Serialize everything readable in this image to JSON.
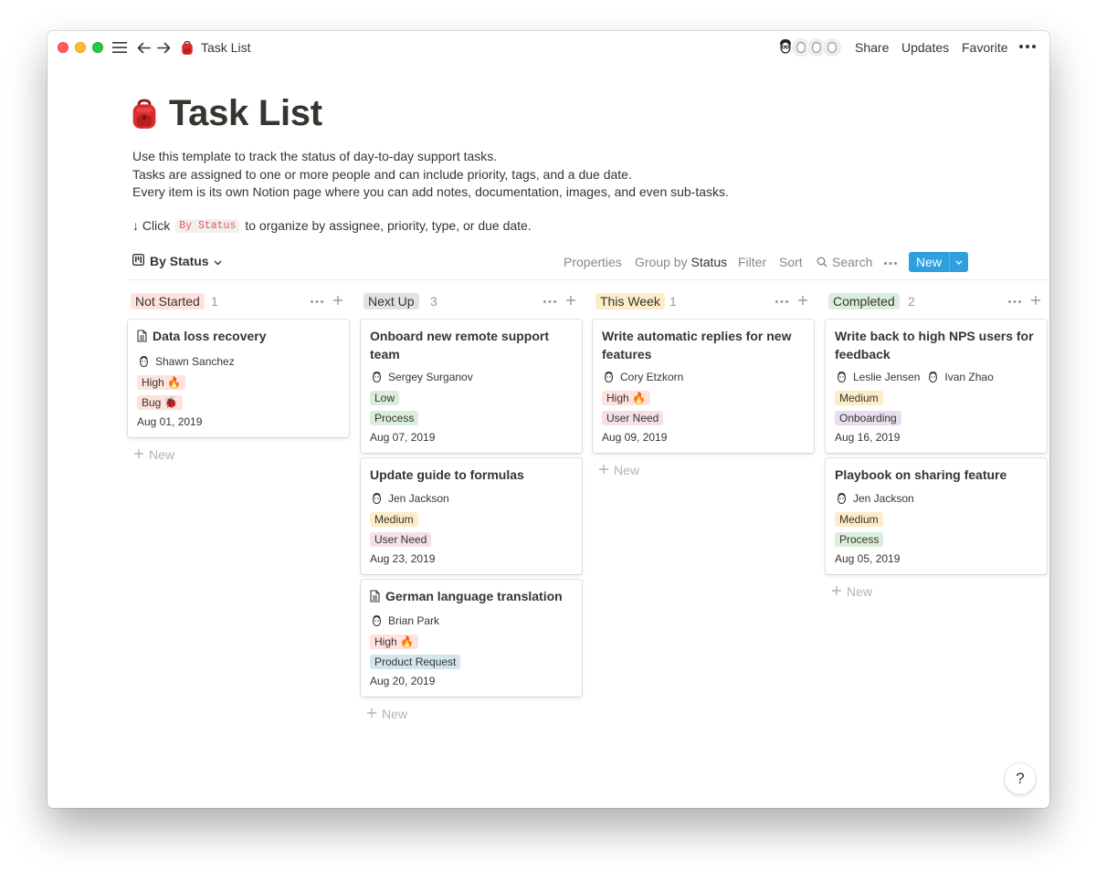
{
  "titlebar": {
    "title": "Task List",
    "share": "Share",
    "updates": "Updates",
    "favorite": "Favorite",
    "page_icon": "backpack-icon"
  },
  "page": {
    "title": "Task List",
    "icon": "backpack-icon",
    "description": [
      "Use this template to track the status of day-to-day support tasks.",
      "Tasks are assigned to one or more people and can include priority, tags, and a due date.",
      "Every item is its own Notion page where you can add notes, documentation, images, and even sub-tasks."
    ],
    "hint": {
      "prefix": "↓ Click",
      "code": "By Status",
      "suffix": "to organize by assignee, priority, type, or due date."
    }
  },
  "viewbar": {
    "view_name": "By Status",
    "properties": "Properties",
    "group_by_label": "Group by",
    "group_by_value": "Status",
    "filter": "Filter",
    "sort": "Sort",
    "search": "Search",
    "new": "New"
  },
  "colors": {
    "accent": "#2f9fe0",
    "not_started": "#ffe2dd",
    "next_up": "#e3e2e0",
    "this_week": "#fdecc8",
    "completed": "#dbeddb",
    "tag_red": "#ffe2dd",
    "tag_green": "#dbeddb",
    "tag_yellow": "#fdecc8",
    "tag_pink": "#f5e0e9",
    "tag_blue": "#d3e5ef",
    "tag_purple": "#e8deee"
  },
  "board": {
    "new_label": "New",
    "columns": [
      {
        "name": "Not Started",
        "count": "1",
        "cards": [
          {
            "title": "Data loss recovery",
            "doc": true,
            "people": [
              "Shawn Sanchez"
            ],
            "priority": "High 🔥",
            "type": "Bug 🐞",
            "date": "Aug 01, 2019"
          }
        ]
      },
      {
        "name": "Next Up",
        "count": "3",
        "cards": [
          {
            "title": "Onboard new remote support team",
            "doc": false,
            "people": [
              "Sergey Surganov"
            ],
            "priority": "Low",
            "type": "Process",
            "date": "Aug 07, 2019"
          },
          {
            "title": "Update guide to formulas",
            "doc": false,
            "people": [
              "Jen Jackson"
            ],
            "priority": "Medium",
            "type": "User Need",
            "date": "Aug 23, 2019"
          },
          {
            "title": "German language translation",
            "doc": true,
            "people": [
              "Brian Park"
            ],
            "priority": "High 🔥",
            "type": "Product Request",
            "date": "Aug 20, 2019"
          }
        ]
      },
      {
        "name": "This Week",
        "count": "1",
        "cards": [
          {
            "title": "Write automatic replies for new features",
            "doc": false,
            "people": [
              "Cory Etzkorn"
            ],
            "priority": "High 🔥",
            "type": "User Need",
            "date": "Aug 09, 2019"
          }
        ]
      },
      {
        "name": "Completed",
        "count": "2",
        "cards": [
          {
            "title": "Write back to high NPS users for feedback",
            "doc": false,
            "people": [
              "Leslie Jensen",
              "Ivan Zhao"
            ],
            "priority": "Medium",
            "type": "Onboarding",
            "date": "Aug 16, 2019"
          },
          {
            "title": "Playbook on sharing feature",
            "doc": false,
            "people": [
              "Jen Jackson"
            ],
            "priority": "Medium",
            "type": "Process",
            "date": "Aug 05, 2019"
          }
        ]
      }
    ]
  },
  "help": "?"
}
